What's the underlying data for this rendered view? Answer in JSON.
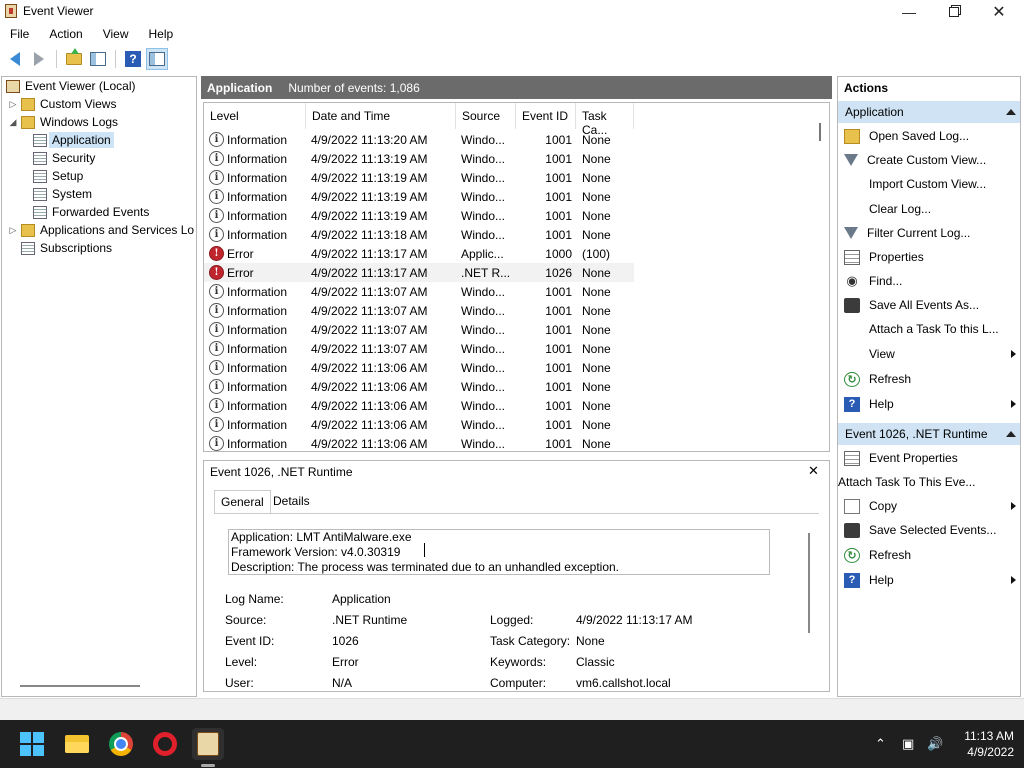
{
  "window": {
    "title": "Event Viewer",
    "min": "—",
    "close": "✕"
  },
  "menu": [
    "File",
    "Action",
    "View",
    "Help"
  ],
  "tree": {
    "root": "Event Viewer (Local)",
    "custom_views": "Custom Views",
    "windows_logs": "Windows Logs",
    "logs": [
      "Application",
      "Security",
      "Setup",
      "System",
      "Forwarded Events"
    ],
    "app_services": "Applications and Services Lo",
    "subscriptions": "Subscriptions"
  },
  "center": {
    "title": "Application",
    "count": "Number of events: 1,086",
    "columns": [
      "Level",
      "Date and Time",
      "Source",
      "Event ID",
      "Task Ca..."
    ],
    "rows": [
      {
        "level": "Information",
        "date": "4/9/2022 11:13:20 AM",
        "source": "Windo...",
        "id": "1001",
        "task": "None"
      },
      {
        "level": "Information",
        "date": "4/9/2022 11:13:19 AM",
        "source": "Windo...",
        "id": "1001",
        "task": "None"
      },
      {
        "level": "Information",
        "date": "4/9/2022 11:13:19 AM",
        "source": "Windo...",
        "id": "1001",
        "task": "None"
      },
      {
        "level": "Information",
        "date": "4/9/2022 11:13:19 AM",
        "source": "Windo...",
        "id": "1001",
        "task": "None"
      },
      {
        "level": "Information",
        "date": "4/9/2022 11:13:19 AM",
        "source": "Windo...",
        "id": "1001",
        "task": "None"
      },
      {
        "level": "Information",
        "date": "4/9/2022 11:13:18 AM",
        "source": "Windo...",
        "id": "1001",
        "task": "None"
      },
      {
        "level": "Error",
        "date": "4/9/2022 11:13:17 AM",
        "source": "Applic...",
        "id": "1000",
        "task": "(100)"
      },
      {
        "level": "Error",
        "date": "4/9/2022 11:13:17 AM",
        "source": ".NET R...",
        "id": "1026",
        "task": "None"
      },
      {
        "level": "Information",
        "date": "4/9/2022 11:13:07 AM",
        "source": "Windo...",
        "id": "1001",
        "task": "None"
      },
      {
        "level": "Information",
        "date": "4/9/2022 11:13:07 AM",
        "source": "Windo...",
        "id": "1001",
        "task": "None"
      },
      {
        "level": "Information",
        "date": "4/9/2022 11:13:07 AM",
        "source": "Windo...",
        "id": "1001",
        "task": "None"
      },
      {
        "level": "Information",
        "date": "4/9/2022 11:13:07 AM",
        "source": "Windo...",
        "id": "1001",
        "task": "None"
      },
      {
        "level": "Information",
        "date": "4/9/2022 11:13:06 AM",
        "source": "Windo...",
        "id": "1001",
        "task": "None"
      },
      {
        "level": "Information",
        "date": "4/9/2022 11:13:06 AM",
        "source": "Windo...",
        "id": "1001",
        "task": "None"
      },
      {
        "level": "Information",
        "date": "4/9/2022 11:13:06 AM",
        "source": "Windo...",
        "id": "1001",
        "task": "None"
      },
      {
        "level": "Information",
        "date": "4/9/2022 11:13:06 AM",
        "source": "Windo...",
        "id": "1001",
        "task": "None"
      },
      {
        "level": "Information",
        "date": "4/9/2022 11:13:06 AM",
        "source": "Windo...",
        "id": "1001",
        "task": "None"
      }
    ],
    "highlighted_row": 7
  },
  "detail": {
    "title": "Event 1026, .NET Runtime",
    "close": "✕",
    "tabs": [
      "General",
      "Details"
    ],
    "desc_lines": [
      "Application: LMT AntiMalware.exe",
      "Framework Version: v4.0.30319",
      "Description: The process was terminated due to an unhandled exception."
    ],
    "log_name_label": "Log Name:",
    "log_name": "Application",
    "source_label": "Source:",
    "source": ".NET Runtime",
    "logged_label": "Logged:",
    "logged": "4/9/2022 11:13:17 AM",
    "event_id_label": "Event ID:",
    "event_id": "1026",
    "task_cat_label": "Task Category:",
    "task_cat": "None",
    "level_label": "Level:",
    "level": "Error",
    "keywords_label": "Keywords:",
    "keywords": "Classic",
    "user_label": "User:",
    "user": "N/A",
    "computer_label": "Computer:",
    "computer": "vm6.callshot.local"
  },
  "actions": {
    "title": "Actions",
    "section1": "Application",
    "items1": [
      {
        "label": "Open Saved Log...",
        "icon": "folder-icon",
        "more": false
      },
      {
        "label": "Create Custom View...",
        "icon": "filter-icon",
        "more": false
      },
      {
        "label": "Import Custom View...",
        "icon": "",
        "more": false
      },
      {
        "label": "Clear Log...",
        "icon": "",
        "more": false
      },
      {
        "label": "Filter Current Log...",
        "icon": "filter-icon",
        "more": false
      },
      {
        "label": "Properties",
        "icon": "properties-icon",
        "more": false
      },
      {
        "label": "Find...",
        "icon": "binoculars-icon",
        "more": false
      },
      {
        "label": "Save All Events As...",
        "icon": "save-icon",
        "more": false
      },
      {
        "label": "Attach a Task To this L...",
        "icon": "",
        "more": false
      },
      {
        "label": "View",
        "icon": "",
        "more": true
      },
      {
        "label": "Refresh",
        "icon": "refresh-icon",
        "more": false
      },
      {
        "label": "Help",
        "icon": "help-icon",
        "more": true
      }
    ],
    "section2": "Event 1026, .NET Runtime",
    "items2": [
      {
        "label": "Event Properties",
        "icon": "properties-icon",
        "more": false
      },
      {
        "label": "Attach Task To This Eve...",
        "icon": "clock-icon",
        "more": false
      },
      {
        "label": "Copy",
        "icon": "copy-icon",
        "more": true
      },
      {
        "label": "Save Selected Events...",
        "icon": "save-icon",
        "more": false
      },
      {
        "label": "Refresh",
        "icon": "refresh-icon",
        "more": false
      },
      {
        "label": "Help",
        "icon": "help-icon",
        "more": true
      }
    ]
  },
  "taskbar": {
    "time": "11:13 AM",
    "date": "4/9/2022"
  }
}
